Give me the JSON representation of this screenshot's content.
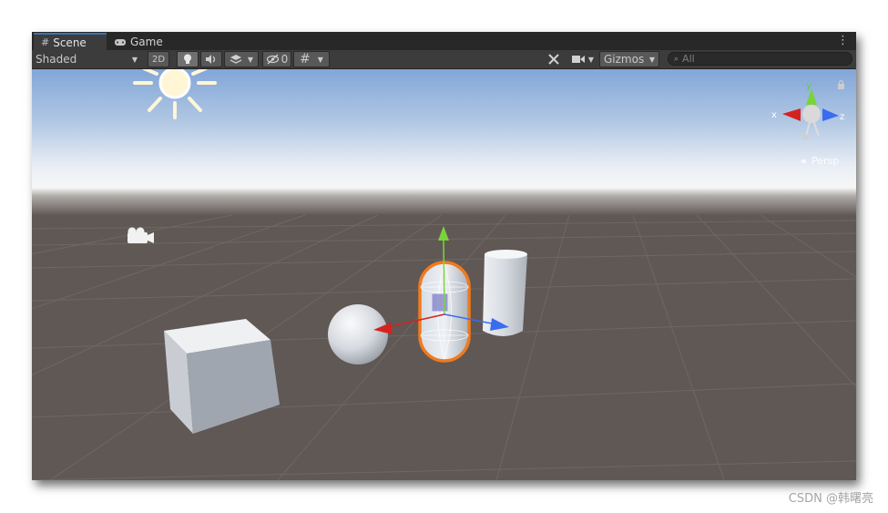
{
  "tabs": [
    {
      "label": "Scene",
      "icon": "hash-icon"
    },
    {
      "label": "Game",
      "icon": "gamepad-icon"
    }
  ],
  "toolbar": {
    "shading_mode": "Shaded",
    "mode_2d": "2D",
    "hidden_count": "0",
    "gizmos_label": "Gizmos",
    "search_placeholder": "All"
  },
  "view_gizmo": {
    "axis_x": "x",
    "axis_y": "y",
    "axis_z": "z",
    "projection": "Persp"
  },
  "scene": {
    "objects": [
      "Cube",
      "Sphere",
      "Capsule",
      "Cylinder"
    ],
    "selected_object": "Capsule"
  },
  "colors": {
    "selection_outline": "#f07a1e",
    "axis_x": "#d4231f",
    "axis_y": "#7bd33a",
    "axis_z": "#3a6cf0",
    "ground": "#605855",
    "sky_top": "#82a6d8",
    "horizon": "#f3f3f4"
  },
  "watermark": "CSDN @韩曙亮"
}
